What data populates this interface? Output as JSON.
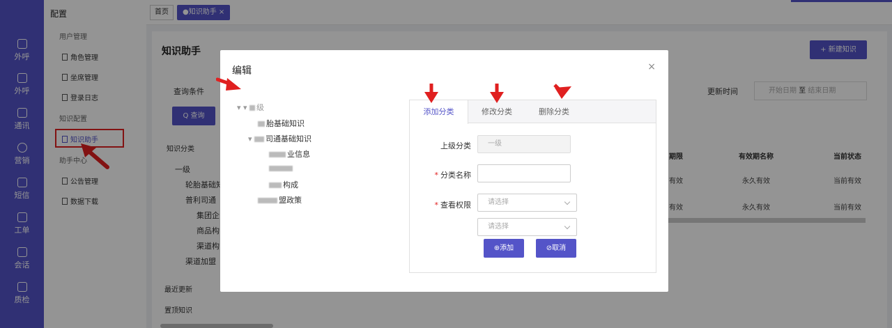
{
  "nav": {
    "items": [
      {
        "label": "外呼"
      },
      {
        "label": "外呼"
      },
      {
        "label": "通讯"
      },
      {
        "label": "营销"
      },
      {
        "label": "短信"
      },
      {
        "label": "工单"
      },
      {
        "label": "会话"
      },
      {
        "label": "质检"
      }
    ]
  },
  "sidebar": {
    "title": "配置",
    "group_user": "用户管理",
    "item_role": "角色管理",
    "item_seat": "坐席管理",
    "item_login": "登录日志",
    "group_knowledge": "知识配置",
    "item_assistant": "知识助手",
    "group_helper": "助手中心",
    "item_notice": "公告管理",
    "item_download": "数据下载"
  },
  "tabs": {
    "home": "首页",
    "active": "●知识助手 ×"
  },
  "page": {
    "title": "知识助手",
    "new_button": "+ 新建知识",
    "query_label": "查询条件",
    "query_button": "Q 查询",
    "update_time_label": "更新时间",
    "start_date": "开始日期",
    "to": "至",
    "end_date": "结束日期",
    "category_label": "知识分类",
    "tree": [
      "一级",
      "轮胎基础知",
      "普利司通",
      "集团企",
      "商品构",
      "渠道构",
      "渠道加盟"
    ],
    "recent": "最近更新",
    "pinned": "置顶知识"
  },
  "table": {
    "headers": [
      "期限",
      "有效期名称",
      "当前状态"
    ],
    "rows": [
      [
        "有效",
        "永久有效",
        "当前有效"
      ],
      [
        "有效",
        "永久有效",
        "当前有效"
      ]
    ]
  },
  "modal": {
    "title": "编辑",
    "close": "×",
    "tree": [
      "级",
      "胎基础知识",
      "司通基础知识",
      "业信息",
      "",
      "构成",
      "盟政策"
    ],
    "tabs": [
      "添加分类",
      "修改分类",
      "删除分类"
    ],
    "parent_label": "上级分类",
    "parent_value": "一级",
    "name_label": "分类名称",
    "perm_label": "查看权限",
    "select_placeholder": "请选择",
    "select_placeholder2": "请选择",
    "add_button": "⊕添加",
    "cancel_button": "⊘取消"
  },
  "colors": {
    "brand": "#5454c8",
    "annotation": "#e02020"
  }
}
